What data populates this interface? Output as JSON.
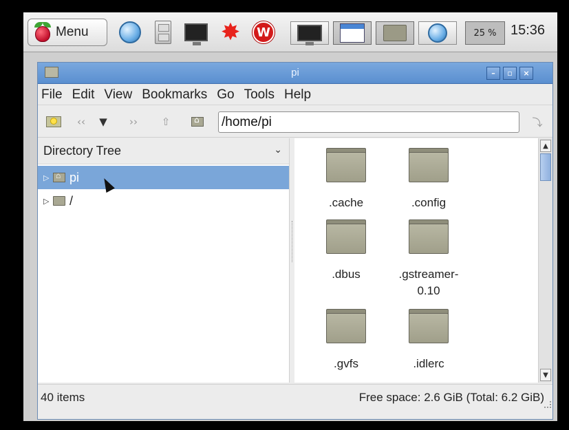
{
  "panel": {
    "menu_label": "Menu",
    "cpu_usage": "25 %",
    "clock": "15:36",
    "launchers": [
      "web-browser-icon",
      "file-cabinet-icon",
      "terminal-icon",
      "mathematica-icon",
      "wolfram-icon"
    ],
    "tasks": [
      "terminal-task-icon",
      "window-task-icon",
      "file-manager-task-icon",
      "browser-task-icon"
    ]
  },
  "window": {
    "title": "pi",
    "menu": [
      "File",
      "Edit",
      "View",
      "Bookmarks",
      "Go",
      "Tools",
      "Help"
    ],
    "path": "/home/pi",
    "side_pane": {
      "mode": "Directory Tree",
      "items": [
        {
          "label": "pi",
          "selected": true
        },
        {
          "label": "/",
          "selected": false
        }
      ]
    },
    "files": [
      ".cache",
      ".config",
      ".dbus",
      ".gstreamer-\n0.10",
      ".gvfs",
      ".idlerc"
    ],
    "status": {
      "items": "40 items",
      "free_space": "Free space: 2.6 GiB (Total: 6.2 GiB)"
    }
  },
  "colors": {
    "titlebar": "#6a9ad6",
    "selection": "#7aa6d9",
    "folder": "#a9a893"
  }
}
